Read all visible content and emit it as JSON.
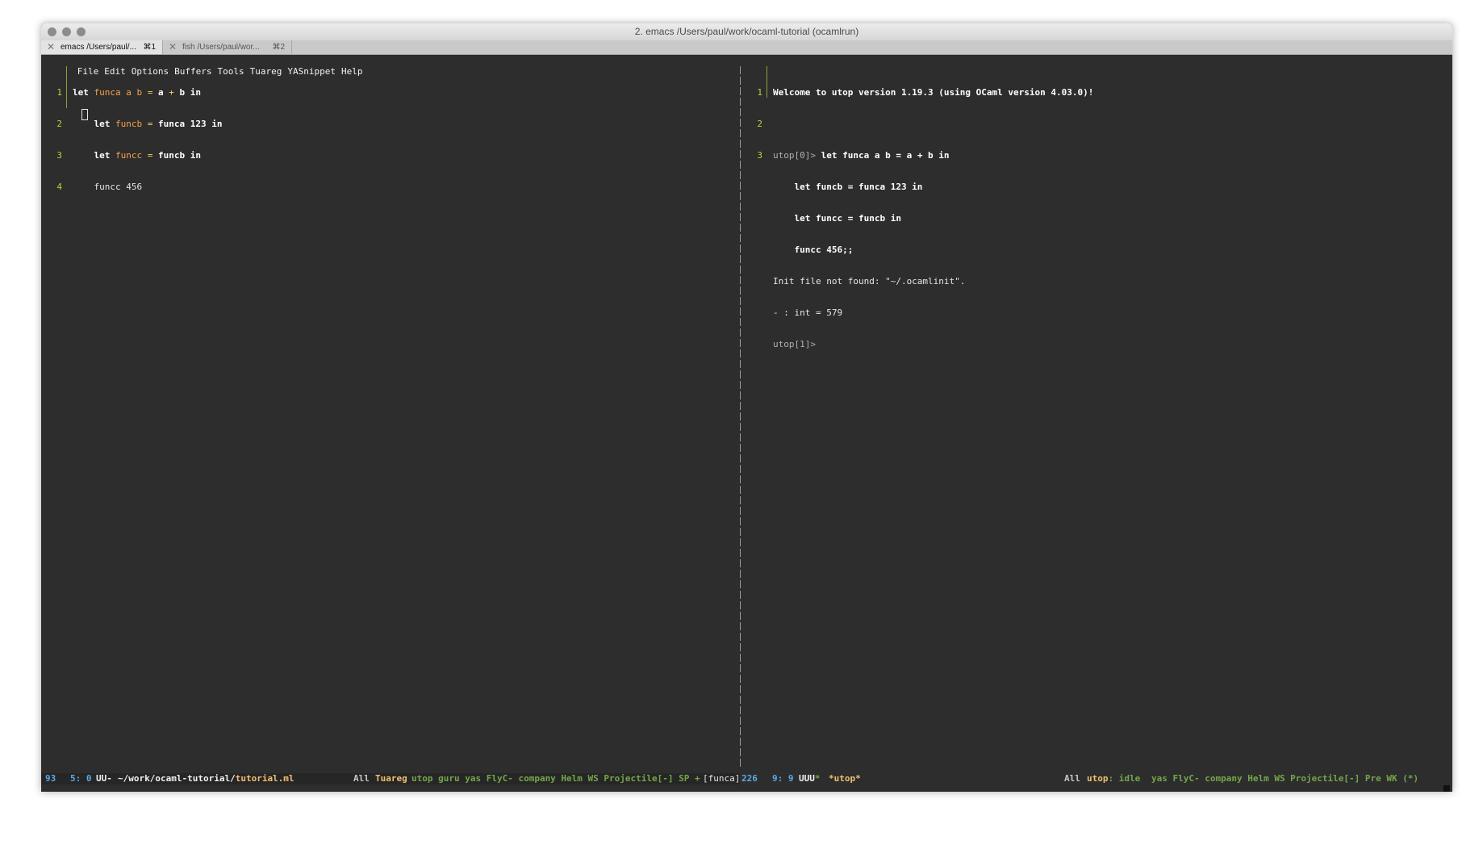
{
  "window": {
    "title": "2. emacs  /Users/paul/work/ocaml-tutorial (ocamlrun)"
  },
  "tabs": [
    {
      "label": "emacs  /Users/paul/...",
      "shortcut": "⌘1",
      "active": true
    },
    {
      "label": "fish  /Users/paul/wor...",
      "shortcut": "⌘2",
      "active": false
    }
  ],
  "menu": [
    "File",
    "Edit",
    "Options",
    "Buffers",
    "Tools",
    "Tuareg",
    "YASnippet",
    "Help"
  ],
  "left_pane": {
    "line_numbers": [
      "1",
      "2",
      "3",
      "4"
    ],
    "lines": [
      {
        "kw1": "let",
        "fn": "funca",
        "args": " a b ",
        "eq": "=",
        "rest1": " a ",
        "op": "+",
        "rest2": " b ",
        "kw2": "in"
      },
      {
        "indent": "    ",
        "kw1": "let",
        "fn": "funcb",
        "eq": "=",
        "rest": " funca 123 ",
        "kw2": "in"
      },
      {
        "indent": "    ",
        "kw1": "let",
        "fn": "funcc",
        "eq": "=",
        "rest": " funcb ",
        "kw2": "in"
      },
      {
        "text": "    funcc 456"
      }
    ]
  },
  "right_pane": {
    "line_numbers": [
      "1",
      "2",
      "3"
    ],
    "welcome": "Welcome to utop version 1.19.3 (using OCaml version 4.03.0)!",
    "prompt0": "utop[0]> ",
    "input_lines": [
      "let funca a b = a + b in",
      "    let funcb = funca 123 in",
      "    let funcc = funcb in",
      "    funcc 456;;"
    ],
    "output_lines": [
      "Init file not found: \"~/.ocamlinit\".",
      "- : int = 579"
    ],
    "prompt1": "utop[1]>"
  },
  "modeline_left": {
    "num": "93",
    "pos": "5: 0",
    "state": "UU-",
    "path_prefix": "~/work/ocaml-tutorial/",
    "file": "tutorial.ml",
    "all": "All",
    "mode": "Tuareg",
    "minor": "utop guru yas FlyC- company Helm WS Projectile[-] SP +",
    "func": "[funca]"
  },
  "modeline_right": {
    "num": "226",
    "pos": "9: 9",
    "state": "UUU",
    "star": "*",
    "buffer": "*utop*",
    "all": "All",
    "mode": "utop",
    "status": ": idle",
    "minor": "yas FlyC- company Helm WS Projectile[-] Pre WK (*)"
  }
}
